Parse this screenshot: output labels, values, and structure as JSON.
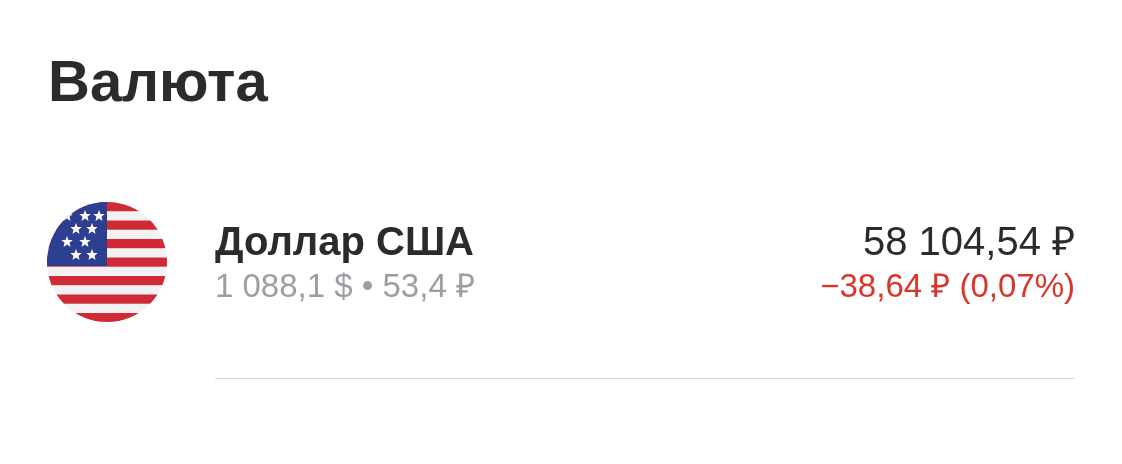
{
  "section": {
    "title": "Валюта"
  },
  "assets": [
    {
      "name": "Доллар США",
      "details": "1 088,1 $ • 53,4 ₽",
      "value": "58 104,54 ₽",
      "change": "−38,64 ₽ (0,07%)",
      "negative": true
    }
  ]
}
